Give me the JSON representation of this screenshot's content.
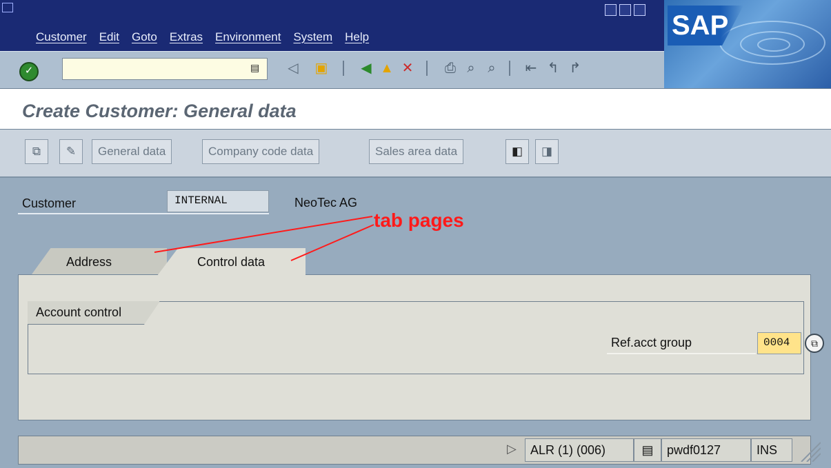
{
  "menu": {
    "items": [
      "Customer",
      "Edit",
      "Goto",
      "Extras",
      "Environment",
      "System",
      "Help"
    ]
  },
  "brand": {
    "logo_text": "SAP"
  },
  "toolbar": {
    "command_field_value": "",
    "icons": [
      "enter-icon",
      "command-history-icon",
      "back-arrow-icon",
      "save-icon",
      "back-icon",
      "exit-icon",
      "cancel-icon",
      "print-icon",
      "find-icon",
      "find-next-icon",
      "first-page-icon",
      "previous-page-icon",
      "next-page-icon"
    ]
  },
  "title": {
    "text": "Create Customer: General data"
  },
  "app_toolbar": {
    "buttons": [
      "General data",
      "Company code data",
      "Sales area data"
    ]
  },
  "header": {
    "customer_label": "Customer",
    "customer_value": "INTERNAL",
    "customer_name": "NeoTec AG"
  },
  "annotation": {
    "text": "tab pages",
    "color": "#ff1a1a"
  },
  "tabs": [
    {
      "label": "Address",
      "active": false
    },
    {
      "label": "Control data",
      "active": true
    }
  ],
  "group": {
    "title": "Account control",
    "ref_label": "Ref.acct group",
    "ref_value": "0004"
  },
  "status": {
    "system": "ALR (1) (006)",
    "server": "pwdf0127",
    "mode": "INS"
  }
}
